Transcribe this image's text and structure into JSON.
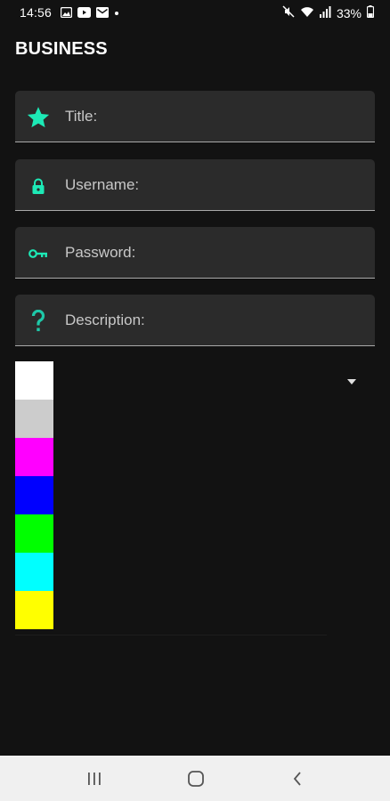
{
  "status_bar": {
    "time": "14:56",
    "battery": "33%",
    "left_icons": [
      "image-icon",
      "youtube-icon",
      "mail-icon",
      "dot-icon"
    ],
    "right_icons": [
      "mute-icon",
      "wifi-icon",
      "signal-icon",
      "battery-icon"
    ]
  },
  "header": {
    "title": "BUSINESS"
  },
  "form": {
    "fields": [
      {
        "label": "Title:",
        "icon": "star-icon",
        "icon_color": "#1de9b6"
      },
      {
        "label": "Username:",
        "icon": "lock-icon",
        "icon_color": "#1de9b6"
      },
      {
        "label": "Password:",
        "icon": "key-icon",
        "icon_color": "#1de9b6"
      },
      {
        "label": "Description:",
        "icon": "question-icon",
        "icon_color": "#1de9b6"
      }
    ]
  },
  "color_picker": {
    "options": [
      "#ffffff",
      "#cccccc",
      "#ff00ff",
      "#0000ff",
      "#00ff00",
      "#00ffff",
      "#ffff00"
    ]
  },
  "nav_bar": {
    "buttons": [
      "recents-button",
      "home-button",
      "back-button"
    ]
  },
  "colors": {
    "background": "#121212",
    "field_background": "#2b2b2b",
    "accent": "#1de9b6",
    "label": "#c8c8c8"
  }
}
